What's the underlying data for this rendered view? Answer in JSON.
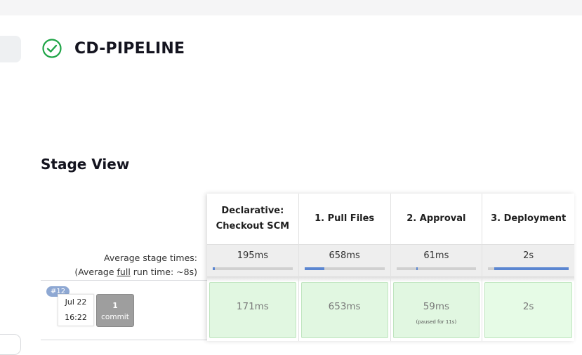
{
  "page": {
    "title": "CD-PIPELINE",
    "status_icon": "success-check-icon",
    "status_color": "#1ea446"
  },
  "stage_view": {
    "title": "Stage View",
    "avg_stage_times_label": "Average stage times:",
    "avg_full_prefix": "(Average ",
    "avg_full_link": "full",
    "avg_full_suffix": " run time: ~8s)",
    "stages": [
      {
        "name": "Declarative: Checkout SCM",
        "avg": "195ms",
        "bar_start": 0.0,
        "bar_fill": 0.03
      },
      {
        "name": "1. Pull Files",
        "avg": "658ms",
        "bar_start": 0.0,
        "bar_fill": 0.25
      },
      {
        "name": "2. Approval",
        "avg": "61ms",
        "bar_start": 0.25,
        "bar_fill": 0.02
      },
      {
        "name": "3. Deployment",
        "avg": "2s",
        "bar_start": 0.08,
        "bar_fill": 0.92
      }
    ],
    "run": {
      "badge": "#12",
      "date": "Jul 22",
      "time": "16:22",
      "commit_count": "1",
      "commit_label": "commit",
      "cells": [
        {
          "time": "171ms",
          "note": ""
        },
        {
          "time": "653ms",
          "note": ""
        },
        {
          "time": "59ms",
          "note": "(paused for 11s)"
        },
        {
          "time": "2s",
          "note": ""
        }
      ]
    }
  }
}
